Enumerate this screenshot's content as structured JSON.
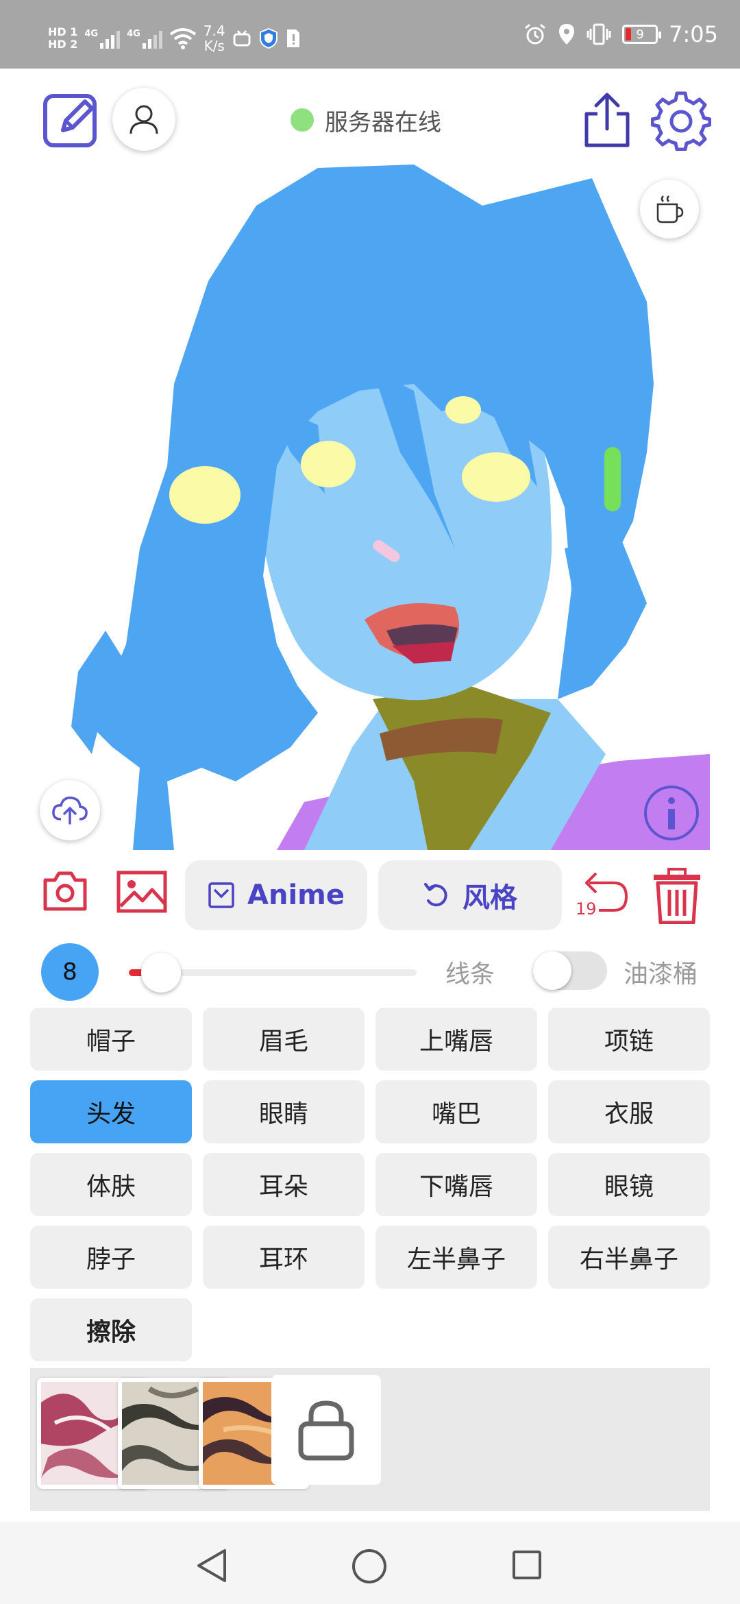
{
  "status_bar": {
    "sim1": "HD 1",
    "sim2": "HD 2",
    "net1": "4G",
    "net2": "4G",
    "speed_value": "7.4",
    "speed_unit": "K/s",
    "battery": "9",
    "time": "7:05",
    "icons": [
      "bilibili-tv-icon",
      "shield-icon",
      "sim-alert-icon",
      "alarm-icon",
      "location-icon",
      "vibrate-icon"
    ]
  },
  "header": {
    "server_status": "服务器在线",
    "server_status_color": "#8fe07f",
    "icons": [
      "edit-icon",
      "user-icon",
      "share-icon",
      "gear-icon"
    ]
  },
  "canvas": {
    "icons": [
      "coffee-cup-icon",
      "cloud-upload-icon",
      "info-icon"
    ]
  },
  "toolbar": {
    "anime_label": "Anime",
    "style_label": "风格",
    "undo_count": "19",
    "icons": [
      "camera-icon",
      "image-icon",
      "anime-box-icon",
      "undo-style-icon",
      "undo-icon",
      "trash-icon"
    ],
    "accent_color": "#4a43c4",
    "danger_color": "#d9344c"
  },
  "brush": {
    "size": "8",
    "slider_fraction": 0.06,
    "line_label": "线条",
    "bucket_label": "油漆桶",
    "bucket_enabled": false
  },
  "parts": [
    {
      "label": "帽子",
      "active": false
    },
    {
      "label": "眉毛",
      "active": false
    },
    {
      "label": "上嘴唇",
      "active": false
    },
    {
      "label": "项链",
      "active": false
    },
    {
      "label": "头发",
      "active": true
    },
    {
      "label": "眼睛",
      "active": false
    },
    {
      "label": "嘴巴",
      "active": false
    },
    {
      "label": "衣服",
      "active": false
    },
    {
      "label": "体肤",
      "active": false
    },
    {
      "label": "耳朵",
      "active": false
    },
    {
      "label": "下嘴唇",
      "active": false
    },
    {
      "label": "眼镜",
      "active": false
    },
    {
      "label": "脖子",
      "active": false
    },
    {
      "label": "耳环",
      "active": false
    },
    {
      "label": "左半鼻子",
      "active": false
    },
    {
      "label": "右半鼻子",
      "active": false
    },
    {
      "label": "擦除",
      "active": false
    }
  ],
  "textures": [
    {
      "name": "texture-pink",
      "colors": [
        "#f2e3e6",
        "#a3294a"
      ]
    },
    {
      "name": "texture-gray",
      "colors": [
        "#d8d3c6",
        "#3b3a33"
      ]
    },
    {
      "name": "texture-orange",
      "colors": [
        "#e8a05f",
        "#3a2430"
      ]
    },
    {
      "name": "texture-locked",
      "icon": "lock-icon"
    }
  ],
  "nav": {
    "icons": [
      "back-icon",
      "home-icon",
      "recent-apps-icon"
    ]
  }
}
